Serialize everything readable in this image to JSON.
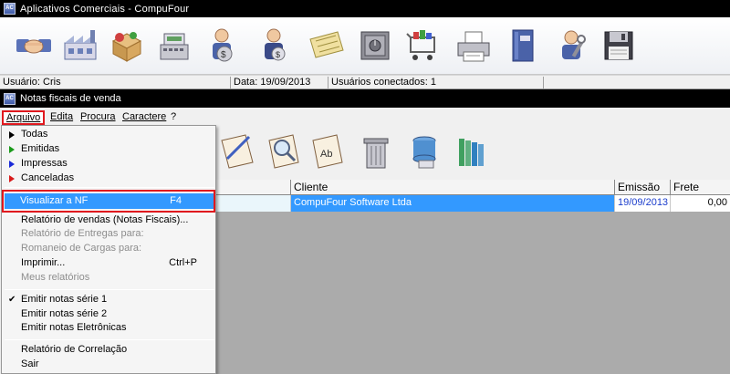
{
  "app": {
    "title": "Aplicativos Comerciais - CompuFour",
    "icon_text": "AC"
  },
  "toolbar_main": {
    "buttons": [
      {
        "name": "handshake-icon"
      },
      {
        "name": "factory-icon"
      },
      {
        "name": "products-box-icon"
      },
      {
        "name": "cash-register-icon"
      },
      {
        "name": "money-bag-person-icon"
      },
      {
        "name": "money-person-icon"
      },
      {
        "name": "ticket-icon"
      },
      {
        "name": "safe-icon"
      },
      {
        "name": "shopping-cart-icon"
      },
      {
        "name": "printer-icon"
      },
      {
        "name": "book-icon"
      },
      {
        "name": "tools-icon"
      },
      {
        "name": "floppy-icon"
      }
    ]
  },
  "status": {
    "user": "Usuário: Cris",
    "date": "Data: 19/09/2013",
    "connected": "Usuários conectados: 1"
  },
  "window": {
    "title": "Notas fiscais de venda",
    "icon_text": "AC"
  },
  "menubar": {
    "arquivo": "Arquivo",
    "edita": "Edita",
    "procura": "Procura",
    "caractere": "Caractere",
    "help": "?"
  },
  "toolbar_sub": {
    "buttons": [
      {
        "name": "edit-document-icon"
      },
      {
        "name": "search-document-icon"
      },
      {
        "name": "text-ab-icon"
      },
      {
        "name": "trash-icon"
      },
      {
        "name": "database-icon"
      },
      {
        "name": "books-stack-icon"
      }
    ]
  },
  "grid": {
    "columns": {
      "cliente": "Cliente",
      "emissao": "Emissão",
      "frete": "Frete"
    },
    "rows": [
      {
        "cliente": "CompuFour Software Ltda",
        "emissao": "19/09/2013",
        "frete": "0,00"
      }
    ]
  },
  "dropdown": {
    "todas": "Todas",
    "emitidas": "Emitidas",
    "impressas": "Impressas",
    "canceladas": "Canceladas",
    "visualizar": "Visualizar a NF",
    "visualizar_shortcut": "F4",
    "relatorio_vendas": "Relatório de vendas (Notas Fiscais)...",
    "relatorio_entregas": "Relatório de Entregas para:",
    "romaneio": "Romaneio de Cargas para:",
    "imprimir": "Imprimir...",
    "imprimir_shortcut": "Ctrl+P",
    "meus_relatorios": "Meus relatórios",
    "serie1": "Emitir notas série 1",
    "serie2": "Emitir notas série 2",
    "eletronicas": "Emitir notas Eletrônicas",
    "correlacao": "Relatório de Correlação",
    "sair": "Sair"
  },
  "colors": {
    "todas": "#000000",
    "emitidas": "#1a9a1a",
    "impressas": "#1a2ad8",
    "canceladas": "#d81a1a",
    "highlight": "#3399ff",
    "red_box": "#e0181e"
  }
}
